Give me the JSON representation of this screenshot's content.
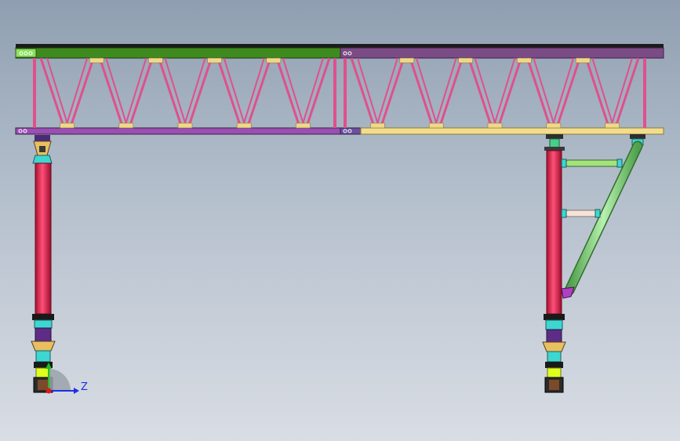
{
  "triad": {
    "z_label": "Z",
    "colors": {
      "z": "#1e2ee8",
      "y": "#18c418",
      "x": "#e01818"
    }
  },
  "model": {
    "colors": {
      "chord_green": "#3f8a1e",
      "chord_purple": "#7b4b86",
      "chord_yellow": "#f2dd8e",
      "truss_member": "#e0508c",
      "column": "#e01a4e",
      "brace": "#8fd88a",
      "strut": "#a2e37e",
      "strut_light": "#f3e4da",
      "gusset": "#f0d88a"
    }
  }
}
